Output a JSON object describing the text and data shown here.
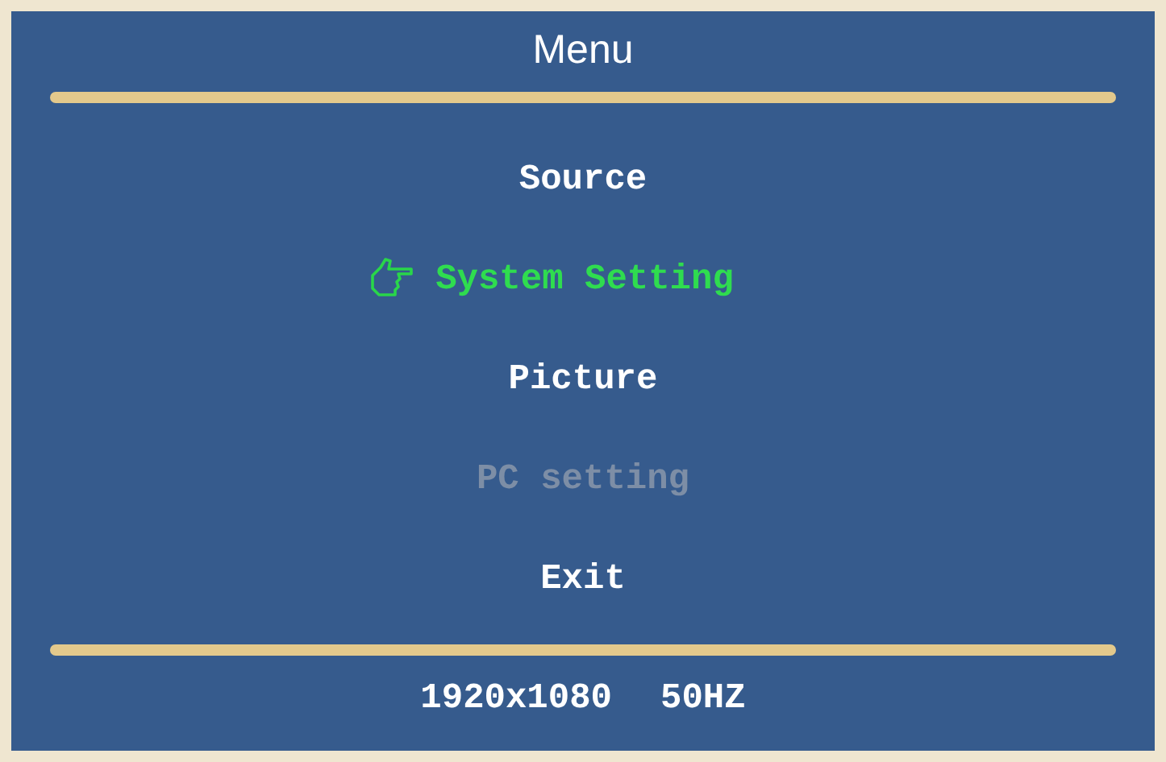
{
  "title": "Menu",
  "items": [
    {
      "label": "Source",
      "selected": false,
      "disabled": false
    },
    {
      "label": "System Setting",
      "selected": true,
      "disabled": false
    },
    {
      "label": "Picture",
      "selected": false,
      "disabled": false
    },
    {
      "label": "PC setting",
      "selected": false,
      "disabled": true
    },
    {
      "label": "Exit",
      "selected": false,
      "disabled": false
    }
  ],
  "status_bar": {
    "resolution": "1920x1080",
    "refresh_rate": "50HZ"
  }
}
